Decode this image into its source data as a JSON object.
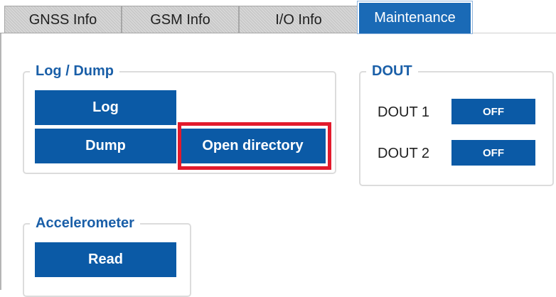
{
  "tabs": [
    {
      "label": "GNSS Info",
      "active": false
    },
    {
      "label": "GSM Info",
      "active": false
    },
    {
      "label": "I/O Info",
      "active": false
    },
    {
      "label": "Maintenance",
      "active": true
    }
  ],
  "log_dump": {
    "title": "Log / Dump",
    "log_label": "Log",
    "dump_label": "Dump",
    "open_directory_label": "Open directory"
  },
  "dout": {
    "title": "DOUT",
    "items": [
      {
        "label": "DOUT 1",
        "state": "OFF"
      },
      {
        "label": "DOUT 2",
        "state": "OFF"
      }
    ]
  },
  "accelerometer": {
    "title": "Accelerometer",
    "read_label": "Read"
  },
  "colors": {
    "accent": "#0b5aa6",
    "active_tab": "#1a6ab6",
    "highlight": "#e21a2c",
    "group_title": "#1a5fa8"
  }
}
